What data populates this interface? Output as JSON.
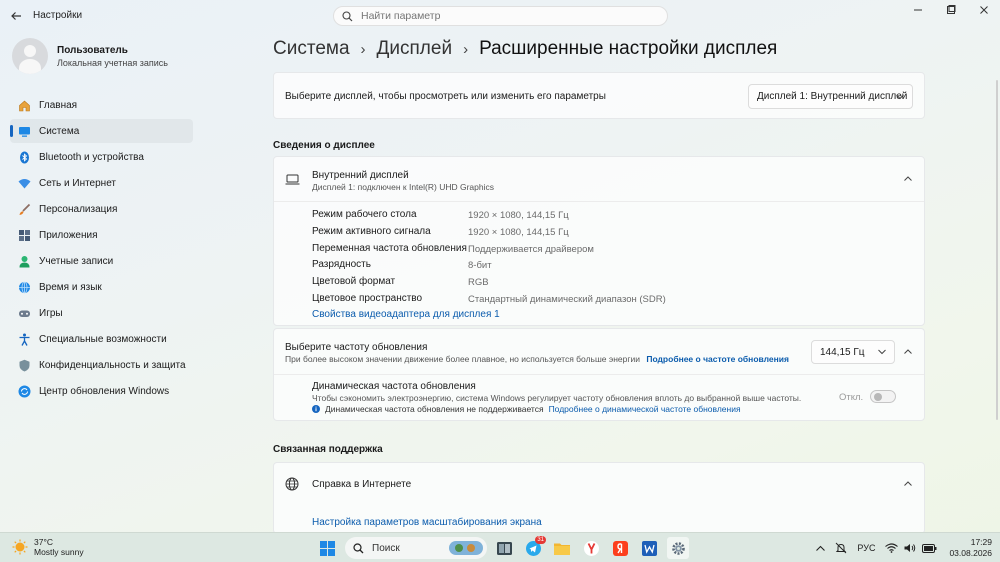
{
  "app": {
    "title": "Настройки"
  },
  "search": {
    "placeholder": "Найти параметр"
  },
  "profile": {
    "name": "Пользователь",
    "account_type": "Локальная учетная запись"
  },
  "sidebar": {
    "items": [
      {
        "label": "Главная",
        "icon": "home-icon"
      },
      {
        "label": "Система",
        "icon": "system-icon",
        "active": true
      },
      {
        "label": "Bluetooth и устройства",
        "icon": "bluetooth-icon"
      },
      {
        "label": "Сеть и Интернет",
        "icon": "network-icon"
      },
      {
        "label": "Персонализация",
        "icon": "brush-icon"
      },
      {
        "label": "Приложения",
        "icon": "apps-icon"
      },
      {
        "label": "Учетные записи",
        "icon": "accounts-icon"
      },
      {
        "label": "Время и язык",
        "icon": "time-language-icon"
      },
      {
        "label": "Игры",
        "icon": "games-icon"
      },
      {
        "label": "Специальные возможности",
        "icon": "accessibility-icon"
      },
      {
        "label": "Конфиденциальность и защита",
        "icon": "shield-icon"
      },
      {
        "label": "Центр обновления Windows",
        "icon": "update-icon"
      }
    ]
  },
  "breadcrumb": {
    "part1": "Система",
    "part2": "Дисплей",
    "current": "Расширенные настройки дисплея"
  },
  "display_select": {
    "prompt": "Выберите дисплей, чтобы просмотреть или изменить его параметры",
    "value": "Дисплей 1: Внутренний дисплей"
  },
  "display_info": {
    "section_title": "Сведения о дисплее",
    "header_title": "Внутренний дисплей",
    "header_sub": "Дисплей 1: подключен к Intel(R) UHD Graphics",
    "rows": [
      {
        "label": "Режим рабочего стола",
        "value": "1920 × 1080, 144,15 Гц"
      },
      {
        "label": "Режим активного сигнала",
        "value": "1920 × 1080, 144,15 Гц"
      },
      {
        "label": "Переменная частота обновления",
        "value": "Поддерживается драйвером"
      },
      {
        "label": "Разрядность",
        "value": "8-бит"
      },
      {
        "label": "Цветовой формат",
        "value": "RGB"
      },
      {
        "label": "Цветовое пространство",
        "value": "Стандартный динамический диапазон (SDR)"
      }
    ],
    "adapter_link": "Свойства видеоадаптера для дисплея 1"
  },
  "refresh": {
    "title": "Выберите частоту обновления",
    "sub": "При более высоком значении движение более плавное, но используется больше энергии",
    "sub_link": "Подробнее о частоте обновления",
    "value": "144,15 Гц",
    "dynamic_title": "Динамическая частота обновления",
    "dynamic_sub": "Чтобы сэкономить электроэнергию, система Windows регулирует частоту обновления вплоть до выбранной выше частоты.",
    "dynamic_note": "Динамическая частота обновления не поддерживается",
    "dynamic_link": "Подробнее о динамической частоте обновления",
    "toggle_state": "Откл."
  },
  "support": {
    "section_title": "Связанная поддержка",
    "help_title": "Справка в Интернете",
    "help_link": "Настройка параметров масштабирования экрана"
  },
  "taskbar": {
    "weather_temp": "37°C",
    "weather_desc": "Mostly sunny",
    "search_label": "Поиск",
    "telegram_badge": "31",
    "lang": "РУС",
    "time": "17:29",
    "date": "03.08.2026"
  },
  "colors": {
    "accent": "#1565c0",
    "link": "#0b5cad"
  }
}
